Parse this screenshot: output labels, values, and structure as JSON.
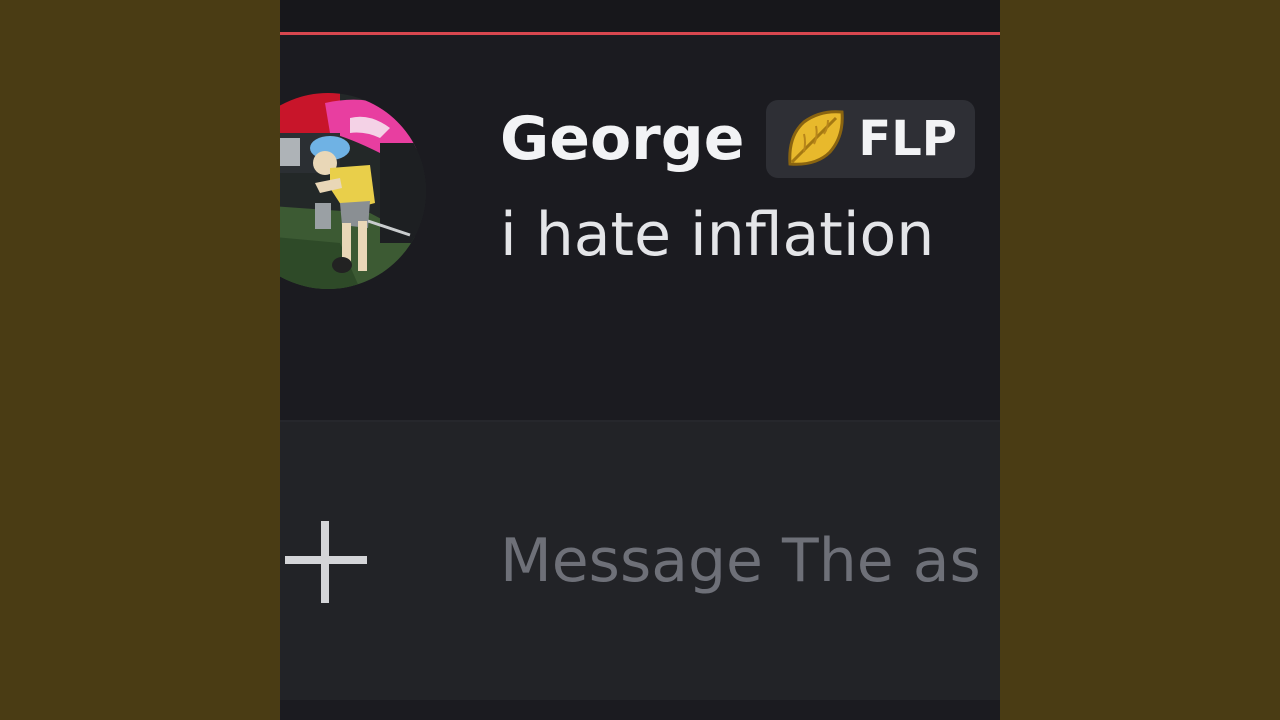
{
  "message": {
    "author": "George",
    "tag_label": "FLP",
    "tag_icon": "leaf-icon",
    "text": "i hate inflation"
  },
  "composer": {
    "placeholder": "Message The as",
    "add_icon": "plus-icon"
  },
  "colors": {
    "background_outer": "#4a3c14",
    "chat_background": "#1b1b20",
    "composer_background": "#222327",
    "new_messages_divider": "#d8474f",
    "tag_background": "#2e2f35",
    "leaf": "#e8b92c"
  }
}
